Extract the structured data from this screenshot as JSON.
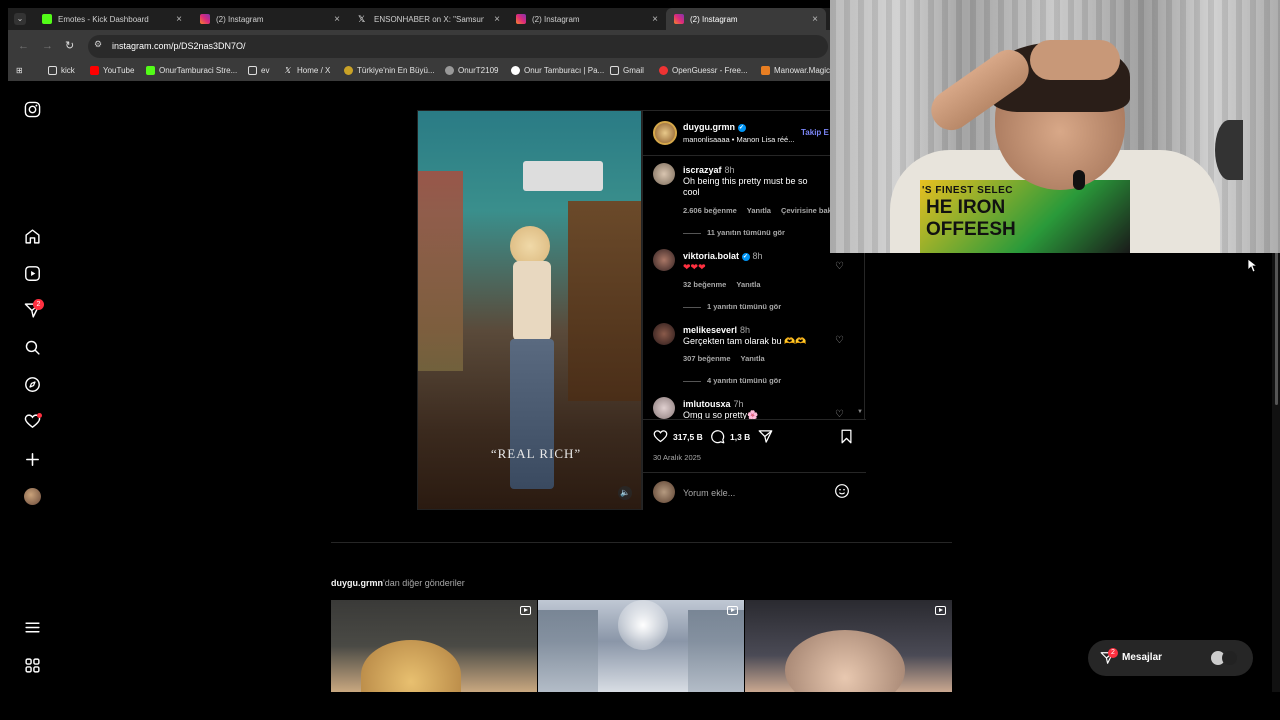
{
  "tabs": [
    {
      "title": "Emotes - Kick Dashboard",
      "icon": "kick-icon",
      "color": "#53fc18"
    },
    {
      "title": "(2) Instagram",
      "icon": "instagram-icon",
      "color": "#e1306c"
    },
    {
      "title": "ENSONHABER on X: \"Samsun'd",
      "icon": "x-icon",
      "color": "#ffffff"
    },
    {
      "title": "(2) Instagram",
      "icon": "instagram-icon",
      "color": "#e1306c"
    },
    {
      "title": "(2) Instagram",
      "icon": "instagram-icon",
      "color": "#e1306c"
    }
  ],
  "address": {
    "url": "instagram.com/p/DS2nas3DN7O/"
  },
  "bookmarks": [
    {
      "label": "kick",
      "icon": "folder-icon"
    },
    {
      "label": "YouTube",
      "icon": "youtube-icon"
    },
    {
      "label": "OnurTamburaci Stre...",
      "icon": "kick-icon"
    },
    {
      "label": "ev",
      "icon": "folder-icon"
    },
    {
      "label": "Home / X",
      "icon": "x-icon"
    },
    {
      "label": "Türkiye'nin En Büyü...",
      "icon": "site-icon"
    },
    {
      "label": "OnurT2109",
      "icon": "site-icon"
    },
    {
      "label": "Onur Tamburacı | Pa...",
      "icon": "patreon-icon"
    },
    {
      "label": "Gmail",
      "icon": "folder-icon"
    },
    {
      "label": "OpenGuessr - Free...",
      "icon": "openguessr-icon"
    },
    {
      "label": "Manowar.Magic",
      "icon": "site-icon"
    }
  ],
  "nav": {
    "notification_badge": "2"
  },
  "post": {
    "author": "duygu.grmn",
    "audio": "manonlisaaaa • Manon Lisa réé...",
    "follow_label": "Takip E",
    "overlay_text": "“REAL RICH”",
    "likes": "317,5 B",
    "comments_count": "1,3 B",
    "date": "30 Aralık 2025",
    "comment_placeholder": "Yorum ekle...",
    "comments": [
      {
        "user": "iscrazyaf",
        "time": "8h",
        "text": "Oh being this pretty must be so cool",
        "likes": "2.606 beğenme",
        "reply": "Yanıtla",
        "translate": "Çevirisine bak",
        "replies": "11 yanıtın tümünü gör"
      },
      {
        "user": "viktoria.bolat",
        "time": "8h",
        "text": "❤❤❤",
        "likes": "32 beğenme",
        "reply": "Yanıtla",
        "replies": "1 yanıtın tümünü gör"
      },
      {
        "user": "melikeseverl",
        "time": "8h",
        "text": "Gerçekten tam olarak bu 🫶🫶",
        "likes": "307 beğenme",
        "reply": "Yanıtla",
        "replies": "4 yanıtın tümünü gör"
      },
      {
        "user": "imlutousxa",
        "time": "7h",
        "text": "Omg u so pretty🌸"
      }
    ]
  },
  "more_posts": {
    "user": "duygu.grmn",
    "suffix": "'dan diğer gönderiler"
  },
  "messages": {
    "label": "Mesajlar",
    "badge": "2"
  },
  "webcam": {
    "shirt_text_1": "'S FINEST SELEC",
    "shirt_text_2": "HE IRON",
    "shirt_text_3": "OFFEESH"
  }
}
